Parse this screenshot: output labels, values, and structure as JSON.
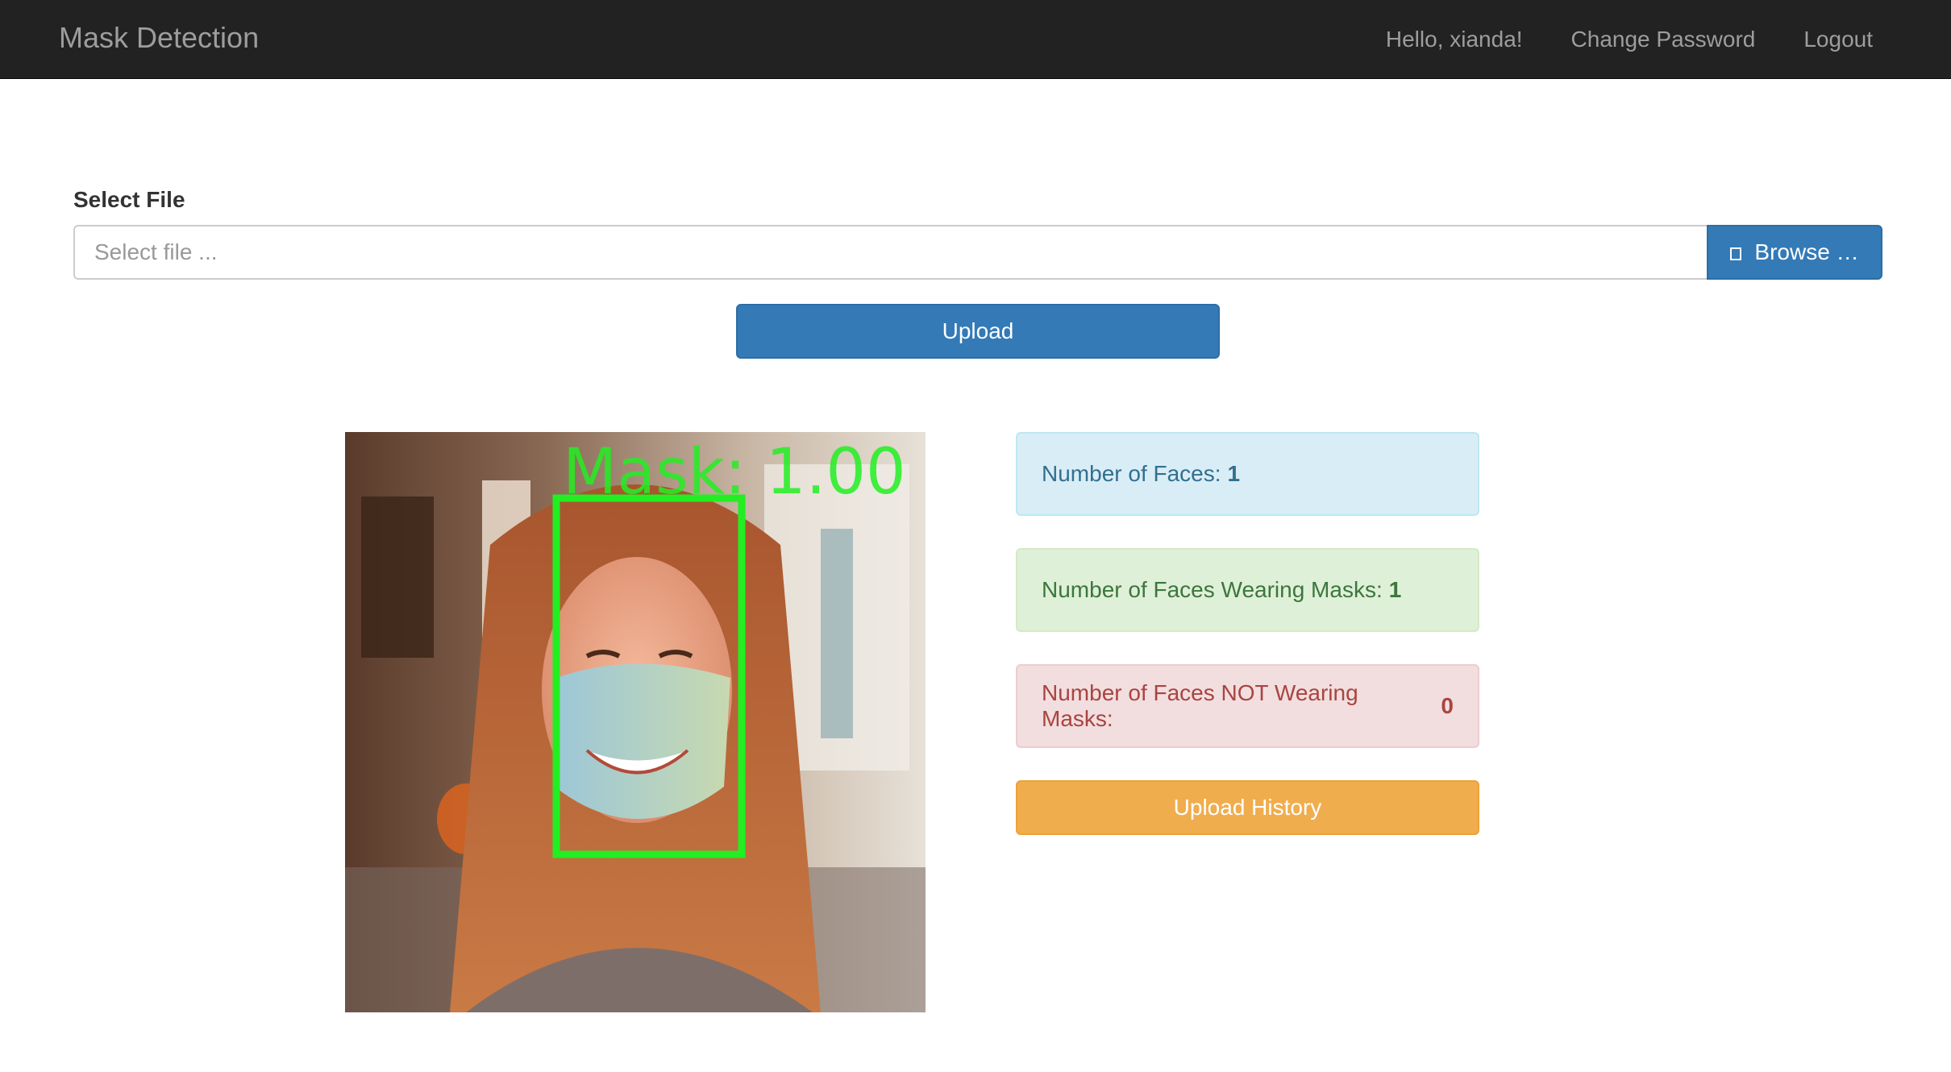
{
  "navbar": {
    "brand": "Mask Detection",
    "greeting": "Hello, xianda!",
    "change_password": "Change Password",
    "logout": "Logout",
    "background_color": "#222222",
    "link_color": "#9d9d9d"
  },
  "upload_form": {
    "label": "Select File",
    "placeholder": "Select file ...",
    "browse_label": "Browse …",
    "browse_icon": "file-icon",
    "upload_label": "Upload"
  },
  "result": {
    "image_icon": "detection-result-image",
    "detection_label": "Mask: 1.00",
    "box_color": "#22ee22",
    "faces_label": "Number of Faces:",
    "faces_count": "1",
    "masked_label": "Number of Faces Wearing Masks:",
    "masked_count": "1",
    "unmasked_label": "Number of Faces NOT Wearing Masks:",
    "unmasked_count": "0",
    "history_label": "Upload History"
  },
  "colors": {
    "primary": "#337ab7",
    "warning": "#f0ad4e",
    "info_bg": "#d9edf7",
    "success_bg": "#dff0d8",
    "danger_bg": "#f2dede"
  }
}
